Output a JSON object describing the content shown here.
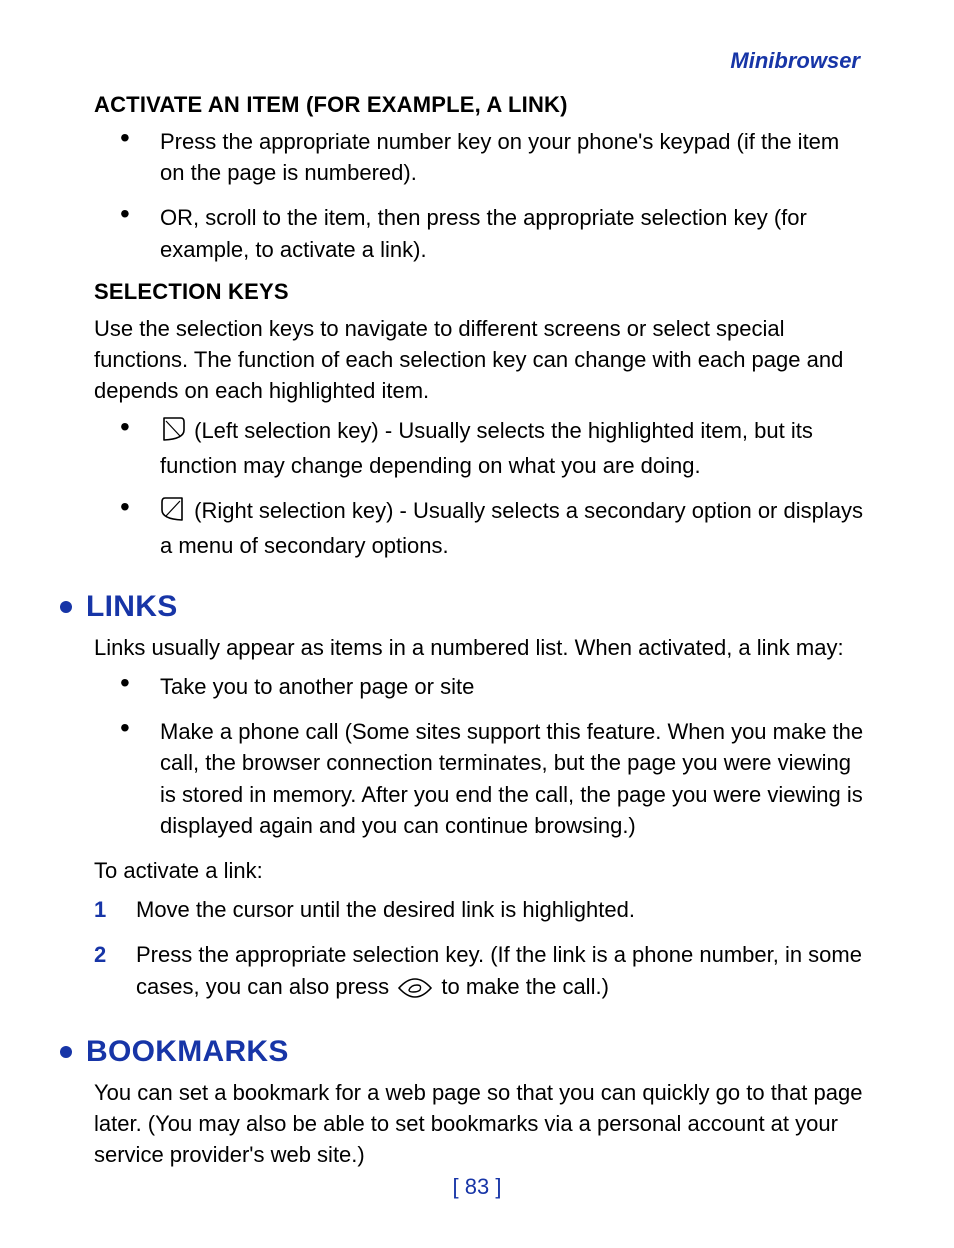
{
  "header": "Minibrowser",
  "section_activate": {
    "heading": "ACTIVATE AN ITEM (FOR EXAMPLE, A LINK)",
    "bullet1": "Press the appropriate number key on your phone's keypad (if the item on the page is numbered).",
    "bullet2": "OR, scroll to the item, then press the appropriate selection key (for example, to activate a link)."
  },
  "section_selection": {
    "heading": "SELECTION KEYS",
    "intro": "Use the selection keys to navigate to different screens or select special functions. The function of each selection key can change with each page and depends on each highlighted item.",
    "left_key": "(Left selection key) - Usually selects the highlighted item, but its function may change depending on what you are doing.",
    "right_key": "(Right selection key) - Usually selects a secondary option or displays a menu of secondary options."
  },
  "section_links": {
    "title": "LINKS",
    "intro": "Links usually appear as items in a numbered list. When activated, a link may:",
    "bullet1": "Take you to another page or site",
    "bullet2": "Make a phone call (Some sites support this feature. When you make the call, the browser connection terminates, but the page you were viewing is stored in memory. After you end the call, the page you were viewing is displayed again and you can continue browsing.)",
    "to_activate": "To activate a link:",
    "step1": "Move the cursor until the desired link is highlighted.",
    "step2a": "Press the appropriate selection key. (If the link is a phone number, in some cases, you can also press ",
    "step2b": " to make the call.)"
  },
  "section_bookmarks": {
    "title": "BOOKMARKS",
    "intro": "You can set a bookmark for a web page so that you can quickly go to that page later. (You may also be able to set bookmarks via a personal account at your service provider's web site.)"
  },
  "page_number": "[ 83 ]"
}
